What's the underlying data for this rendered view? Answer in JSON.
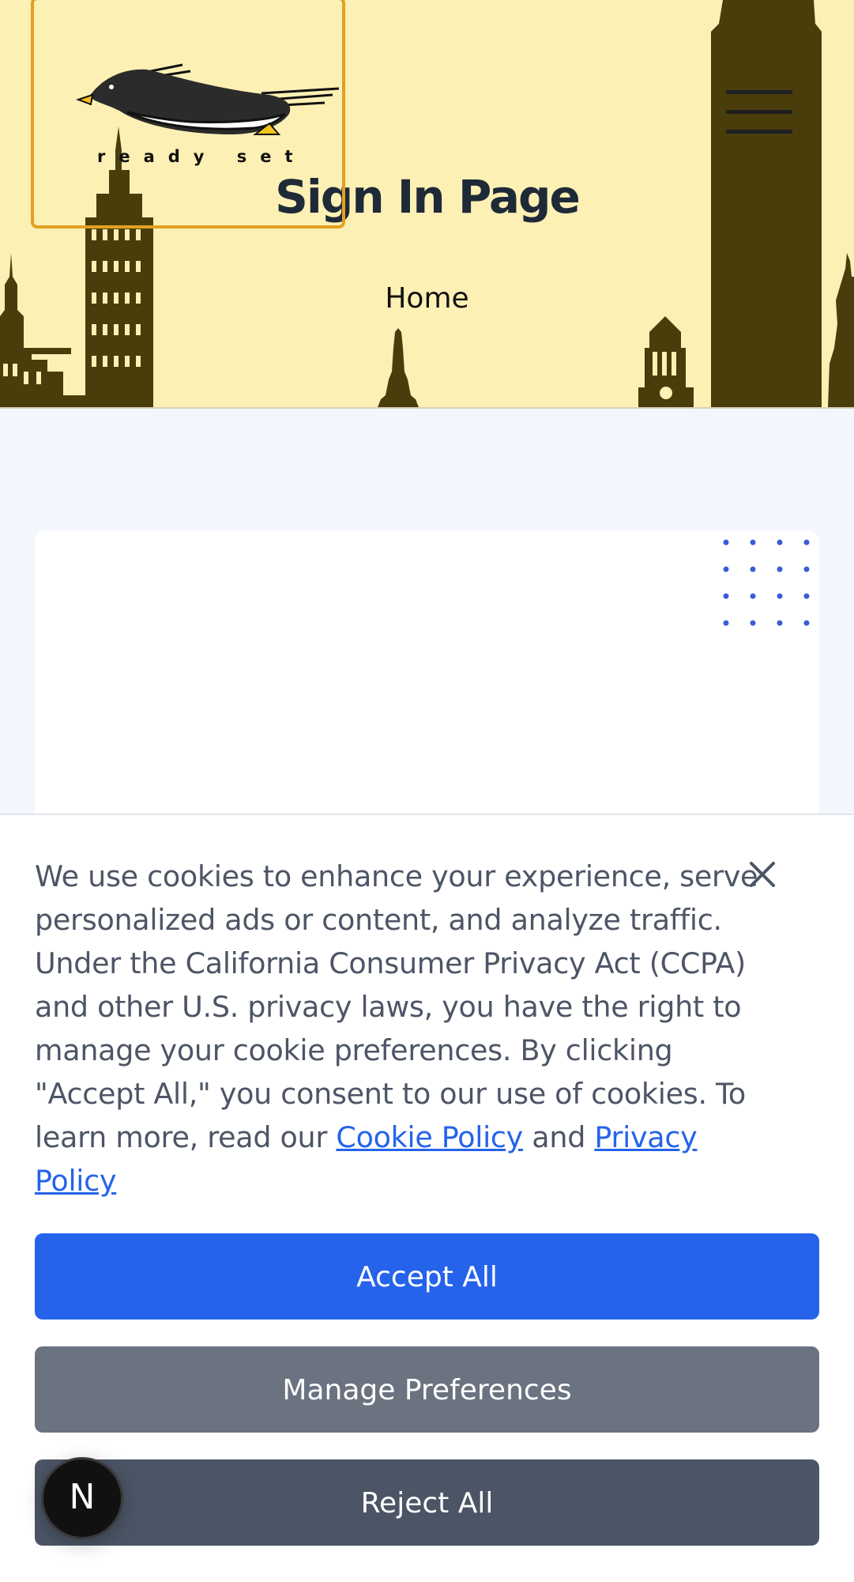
{
  "header": {
    "logo_text": "ready set",
    "page_title": "Sign In Page",
    "breadcrumb": "Home",
    "menu_icon": "hamburger-menu-icon"
  },
  "cookie_banner": {
    "text_main": "We use cookies to enhance your experience, serve personalized ads or content, and analyze traffic. Under the California Consumer Privacy Act (CCPA) and other U.S. privacy laws, you have the right to manage your cookie preferences. By clicking \"Accept All,\" you consent to our use of cookies. To learn more, read our",
    "cookie_policy_link": "Cookie Policy",
    "and_text": "and",
    "privacy_policy_link": "Privacy Policy",
    "close_icon": "close-icon",
    "accept_label": "Accept All",
    "manage_label": "Manage Preferences",
    "reject_label": "Reject All"
  },
  "badge": {
    "label": "N"
  },
  "colors": {
    "hero_bg": "#fdf0b4",
    "skyline": "#4a3d0c",
    "logo_border": "#e3a01f",
    "accent": "#2563eb",
    "manage_button": "#6b7280",
    "reject_button": "#4b5565",
    "dots": "#3b5bdb"
  }
}
